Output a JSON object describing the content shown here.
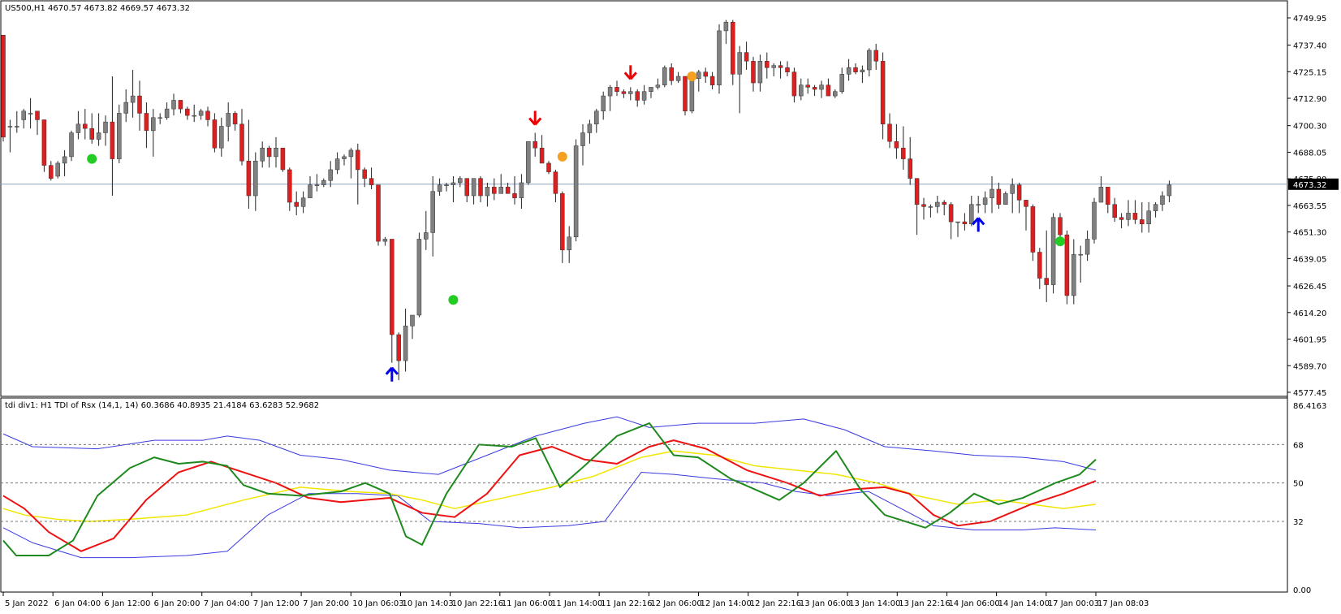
{
  "main_panel": {
    "header": "US500,H1  4670.57 4673.82 4669.57 4673.32",
    "current_price": "4673.32",
    "price_axis_labels": [
      "4749.95",
      "4737.40",
      "4725.15",
      "4712.90",
      "4700.30",
      "4688.05",
      "4675.80",
      "4663.55",
      "4651.30",
      "4639.05",
      "4626.45",
      "4614.20",
      "4601.95",
      "4589.70",
      "4577.45"
    ],
    "price_axis_values": [
      4749.95,
      4737.4,
      4725.15,
      4712.9,
      4700.3,
      4688.05,
      4675.8,
      4663.55,
      4651.3,
      4639.05,
      4626.45,
      4614.2,
      4601.95,
      4589.7,
      4577.45
    ]
  },
  "indicator_panel": {
    "header": "tdi div1: H1 TDI of Rsx  (14,1, 14) 60.3686 40.8935 21.4184 63.6283 52.9682",
    "axis_labels": [
      "86.4163",
      "68",
      "50",
      "32",
      "0.00"
    ],
    "axis_values": [
      86.4163,
      68,
      50,
      32,
      0
    ]
  },
  "time_axis_labels": [
    "5 Jan 2022",
    "6 Jan 04:00",
    "6 Jan 12:00",
    "6 Jan 20:00",
    "7 Jan 04:00",
    "7 Jan 12:00",
    "7 Jan 20:00",
    "10 Jan 06:03",
    "10 Jan 14:03",
    "10 Jan 22:16",
    "11 Jan 06:00",
    "11 Jan 14:00",
    "11 Jan 22:16",
    "12 Jan 06:00",
    "12 Jan 14:00",
    "12 Jan 22:16",
    "13 Jan 06:00",
    "13 Jan 14:00",
    "13 Jan 22:16",
    "14 Jan 06:00",
    "14 Jan 14:00",
    "17 Jan 00:03",
    "17 Jan 08:03"
  ],
  "colors": {
    "bull_candle": "#808080",
    "bear_candle": "#dd1f1f",
    "wick": "#222222",
    "up_arrow": "#0000ee",
    "down_arrow": "#ee0000",
    "green_dot": "#22cc22",
    "orange_dot": "#f5a020",
    "price_line": "#8fa6c2",
    "tdi_band": "#3a3ae0",
    "tdi_rsi": "#1e8a1e",
    "tdi_signal": "#ee1111",
    "tdi_mid": "#f2e600"
  },
  "chart_data": {
    "type": "candlestick",
    "candles": [
      [
        4742,
        4742,
        4693,
        4695
      ],
      [
        4700,
        4703,
        4688,
        4700
      ],
      [
        4700,
        4707,
        4697,
        4700
      ],
      [
        4703,
        4708,
        4699,
        4707
      ],
      [
        4706,
        4713,
        4699,
        4706
      ],
      [
        4707,
        4707,
        4696,
        4703
      ],
      [
        4703,
        4703,
        4679,
        4682
      ],
      [
        4682,
        4684,
        4675,
        4676
      ],
      [
        4677,
        4684,
        4676,
        4683
      ],
      [
        4683,
        4689,
        4677,
        4686
      ],
      [
        4686,
        4698,
        4684,
        4697
      ],
      [
        4697,
        4707,
        4694,
        4701
      ],
      [
        4701,
        4708,
        4694,
        4699
      ],
      [
        4699,
        4706,
        4692,
        4694
      ],
      [
        4694,
        4706,
        4691,
        4697
      ],
      [
        4697,
        4705,
        4691,
        4702
      ],
      [
        4702,
        4723,
        4668,
        4685
      ],
      [
        4685,
        4710,
        4683,
        4706
      ],
      [
        4706,
        4717,
        4702,
        4711
      ],
      [
        4711,
        4726,
        4704,
        4714
      ],
      [
        4714,
        4721,
        4698,
        4706
      ],
      [
        4706,
        4711,
        4690,
        4698
      ],
      [
        4698,
        4708,
        4686,
        4704
      ],
      [
        4704,
        4706,
        4701,
        4704
      ],
      [
        4704,
        4711,
        4703,
        4708
      ],
      [
        4708,
        4715,
        4705,
        4712
      ],
      [
        4712,
        4712,
        4706,
        4708
      ],
      [
        4708,
        4709,
        4703,
        4705
      ],
      [
        4705,
        4710,
        4702,
        4705
      ],
      [
        4705,
        4708,
        4703,
        4707
      ],
      [
        4707,
        4709,
        4700,
        4703
      ],
      [
        4703,
        4706,
        4688,
        4690
      ],
      [
        4690,
        4704,
        4686,
        4700
      ],
      [
        4700,
        4711,
        4693,
        4706
      ],
      [
        4706,
        4707,
        4698,
        4701
      ],
      [
        4701,
        4708,
        4682,
        4684
      ],
      [
        4684,
        4703,
        4662,
        4668
      ],
      [
        4668,
        4688,
        4661,
        4684
      ],
      [
        4684,
        4693,
        4681,
        4690
      ],
      [
        4690,
        4691,
        4681,
        4686
      ],
      [
        4686,
        4695,
        4681,
        4690
      ],
      [
        4690,
        4690,
        4679,
        4680
      ],
      [
        4680,
        4681,
        4661,
        4665
      ],
      [
        4665,
        4670,
        4659,
        4663
      ],
      [
        4663,
        4670,
        4660,
        4667
      ],
      [
        4667,
        4677,
        4667,
        4673
      ],
      [
        4673,
        4678,
        4670,
        4673
      ],
      [
        4673,
        4676,
        4672,
        4675
      ],
      [
        4675,
        4684,
        4672,
        4680
      ],
      [
        4680,
        4688,
        4678,
        4685
      ],
      [
        4685,
        4687,
        4682,
        4686
      ],
      [
        4686,
        4690,
        4676,
        4689
      ],
      [
        4689,
        4692,
        4664,
        4680
      ],
      [
        4680,
        4681,
        4672,
        4676
      ],
      [
        4676,
        4681,
        4671,
        4673
      ],
      [
        4673,
        4673,
        4645,
        4647
      ],
      [
        4647,
        4649,
        4645,
        4648
      ],
      [
        4648,
        4648,
        4591,
        4604
      ],
      [
        4604,
        4605,
        4583,
        4592
      ],
      [
        4592,
        4616,
        4587,
        4608
      ],
      [
        4608,
        4613,
        4602,
        4613
      ],
      [
        4613,
        4651,
        4612,
        4648
      ],
      [
        4648,
        4661,
        4643,
        4651
      ],
      [
        4651,
        4677,
        4640,
        4670
      ],
      [
        4670,
        4676,
        4668,
        4673
      ],
      [
        4673,
        4674,
        4670,
        4673
      ],
      [
        4673,
        4677,
        4665,
        4674
      ],
      [
        4674,
        4677,
        4672,
        4676
      ],
      [
        4676,
        4676,
        4665,
        4668
      ],
      [
        4668,
        4675,
        4664,
        4676
      ],
      [
        4676,
        4677,
        4665,
        4668
      ],
      [
        4668,
        4674,
        4663,
        4672
      ],
      [
        4672,
        4676,
        4666,
        4669
      ],
      [
        4669,
        4678,
        4669,
        4672
      ],
      [
        4672,
        4674,
        4669,
        4669
      ],
      [
        4669,
        4677,
        4664,
        4667
      ],
      [
        4667,
        4678,
        4662,
        4674
      ],
      [
        4674,
        4693,
        4673,
        4693
      ],
      [
        4693,
        4697,
        4686,
        4690
      ],
      [
        4690,
        4696,
        4683,
        4683
      ],
      [
        4683,
        4684,
        4678,
        4679
      ],
      [
        4679,
        4680,
        4665,
        4669
      ],
      [
        4669,
        4670,
        4637,
        4643
      ],
      [
        4643,
        4654,
        4637,
        4649
      ],
      [
        4649,
        4694,
        4647,
        4691
      ],
      [
        4691,
        4701,
        4682,
        4697
      ],
      [
        4697,
        4703,
        4692,
        4701
      ],
      [
        4701,
        4708,
        4697,
        4707
      ],
      [
        4707,
        4716,
        4703,
        4714
      ],
      [
        4714,
        4719,
        4707,
        4718
      ],
      [
        4718,
        4721,
        4714,
        4716
      ],
      [
        4716,
        4717,
        4713,
        4715
      ],
      [
        4715,
        4718,
        4712,
        4716
      ],
      [
        4716,
        4717,
        4709,
        4712
      ],
      [
        4712,
        4719,
        4710,
        4716
      ],
      [
        4716,
        4718,
        4713,
        4718
      ],
      [
        4718,
        4722,
        4717,
        4719
      ],
      [
        4719,
        4728,
        4718,
        4727
      ],
      [
        4727,
        4729,
        4719,
        4721
      ],
      [
        4721,
        4725,
        4720,
        4723
      ],
      [
        4723,
        4723,
        4705,
        4707
      ],
      [
        4707,
        4724,
        4706,
        4722
      ],
      [
        4722,
        4726,
        4716,
        4725
      ],
      [
        4725,
        4727,
        4720,
        4723
      ],
      [
        4723,
        4725,
        4717,
        4719
      ],
      [
        4719,
        4747,
        4715,
        4744
      ],
      [
        4744,
        4749,
        4738,
        4748
      ],
      [
        4748,
        4749,
        4719,
        4724
      ],
      [
        4724,
        4737,
        4706,
        4734
      ],
      [
        4734,
        4739,
        4726,
        4730
      ],
      [
        4730,
        4732,
        4716,
        4720
      ],
      [
        4720,
        4733,
        4716,
        4730
      ],
      [
        4730,
        4734,
        4722,
        4727
      ],
      [
        4727,
        4729,
        4723,
        4728
      ],
      [
        4728,
        4730,
        4722,
        4727
      ],
      [
        4727,
        4730,
        4723,
        4725
      ],
      [
        4725,
        4727,
        4711,
        4714
      ],
      [
        4714,
        4722,
        4712,
        4719
      ],
      [
        4719,
        4722,
        4715,
        4718
      ],
      [
        4718,
        4719,
        4714,
        4717
      ],
      [
        4717,
        4721,
        4713,
        4719
      ],
      [
        4719,
        4722,
        4714,
        4714
      ],
      [
        4714,
        4717,
        4713,
        4716
      ],
      [
        4716,
        4727,
        4715,
        4724
      ],
      [
        4724,
        4731,
        4721,
        4727
      ],
      [
        4727,
        4729,
        4724,
        4725
      ],
      [
        4725,
        4728,
        4720,
        4726
      ],
      [
        4726,
        4736,
        4723,
        4735
      ],
      [
        4735,
        4738,
        4726,
        4730
      ],
      [
        4730,
        4734,
        4694,
        4701
      ],
      [
        4701,
        4706,
        4690,
        4693
      ],
      [
        4693,
        4701,
        4685,
        4690
      ],
      [
        4690,
        4700,
        4680,
        4685
      ],
      [
        4685,
        4695,
        4673,
        4676
      ],
      [
        4676,
        4676,
        4650,
        4664
      ],
      [
        4664,
        4667,
        4657,
        4663
      ],
      [
        4663,
        4664,
        4658,
        4663
      ],
      [
        4663,
        4668,
        4660,
        4665
      ],
      [
        4665,
        4666,
        4659,
        4664
      ],
      [
        4664,
        4665,
        4648,
        4656
      ],
      [
        4656,
        4656,
        4649,
        4656
      ],
      [
        4656,
        4660,
        4652,
        4655
      ],
      [
        4655,
        4668,
        4654,
        4664
      ],
      [
        4664,
        4668,
        4660,
        4664
      ],
      [
        4664,
        4670,
        4660,
        4667
      ],
      [
        4667,
        4677,
        4660,
        4671
      ],
      [
        4671,
        4674,
        4662,
        4664
      ],
      [
        4664,
        4670,
        4664,
        4669
      ],
      [
        4669,
        4676,
        4660,
        4673
      ],
      [
        4673,
        4674,
        4660,
        4666
      ],
      [
        4666,
        4666,
        4652,
        4663
      ],
      [
        4663,
        4664,
        4638,
        4642
      ],
      [
        4642,
        4644,
        4625,
        4630
      ],
      [
        4630,
        4652,
        4619,
        4627
      ],
      [
        4627,
        4660,
        4623,
        4658
      ],
      [
        4658,
        4660,
        4646,
        4650
      ],
      [
        4650,
        4652,
        4618,
        4622
      ],
      [
        4622,
        4648,
        4618,
        4641
      ],
      [
        4641,
        4645,
        4628,
        4641
      ],
      [
        4641,
        4652,
        4638,
        4648
      ],
      [
        4648,
        4667,
        4646,
        4665
      ],
      [
        4665,
        4677,
        4665,
        4672
      ],
      [
        4672,
        4672,
        4660,
        4664
      ],
      [
        4664,
        4667,
        4656,
        4658
      ],
      [
        4658,
        4660,
        4653,
        4657
      ],
      [
        4657,
        4666,
        4654,
        4660
      ],
      [
        4660,
        4666,
        4655,
        4657
      ],
      [
        4657,
        4665,
        4651,
        4655
      ],
      [
        4655,
        4665,
        4651,
        4661
      ],
      [
        4661,
        4665,
        4658,
        4664
      ],
      [
        4664,
        4670,
        4661,
        4668
      ],
      [
        4668,
        4675,
        4665,
        4673
      ]
    ],
    "arrows_up": [
      57,
      143
    ],
    "arrows_down": [
      78,
      92
    ],
    "green_dots": [
      {
        "candle": 13,
        "price": 4685
      },
      {
        "candle": 66,
        "price": 4620
      },
      {
        "candle": 155,
        "price": 4647
      }
    ],
    "orange_dots": [
      {
        "candle": 82,
        "price": 4686
      },
      {
        "candle": 101,
        "price": 4723
      }
    ]
  }
}
